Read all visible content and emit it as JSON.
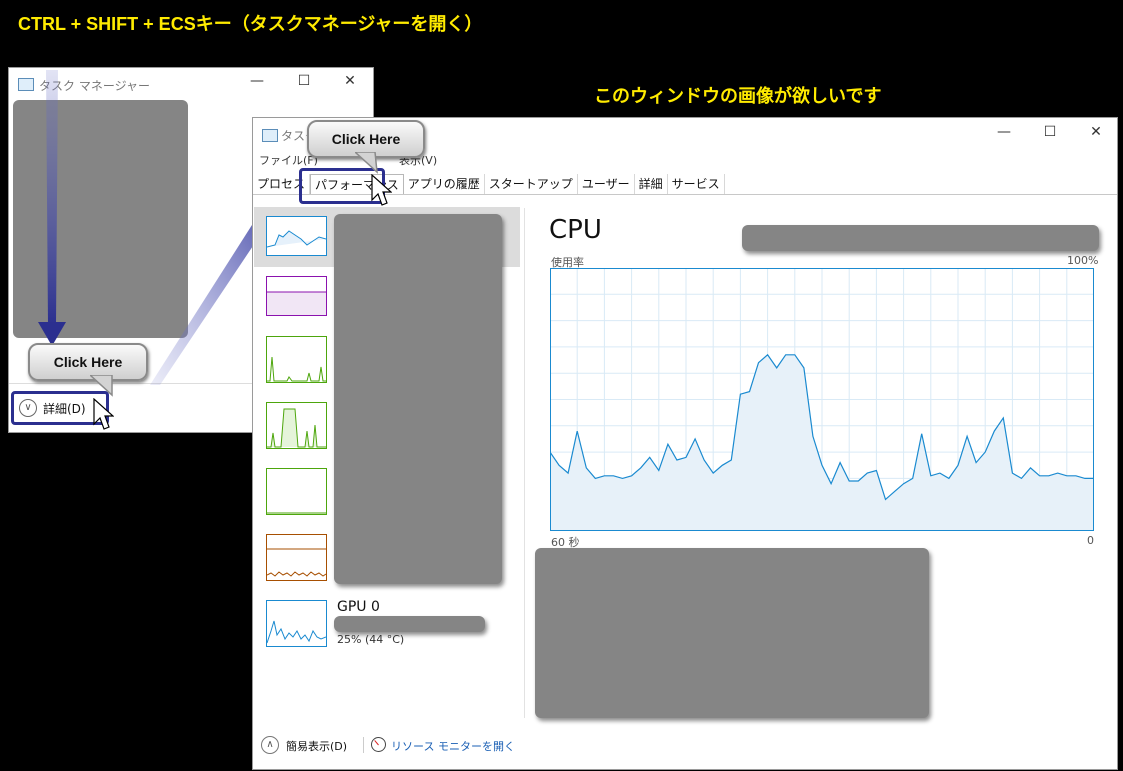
{
  "notes": {
    "top": "CTRL + SHIFT + ECSキー（タスクマネージャーを開く）",
    "window_note": "このウィンドウの画像が欲しいです"
  },
  "small_window": {
    "title": "タスク マネージャー",
    "details_label": "詳細(D)",
    "callout": "Click Here"
  },
  "main_window": {
    "title": "タスク",
    "menu": [
      "ファイル(F)",
      "表示(V)"
    ],
    "tabs": [
      "プロセス",
      "パフォーマンス",
      "アプリの履歴",
      "スタートアップ",
      "ユーザー",
      "詳細",
      "サービス"
    ],
    "active_tab_index": 1,
    "callout": "Click Here",
    "cpu": {
      "title": "CPU",
      "usage_label": "使用率",
      "max_label": "100%",
      "time_left": "60 秒",
      "time_right": "0"
    },
    "gpu": {
      "name": "GPU 0",
      "detail": "25%  (44 °C)"
    },
    "footer": {
      "fewer_details": "簡易表示(D)",
      "resource_monitor": "リソース モニターを開く"
    }
  },
  "colors": {
    "note_yellow": "#ffeb00",
    "highlight_blue": "#2b2f8f",
    "cpu_line": "#1a8ad0",
    "memory": "#8b12ae",
    "disk": "#4da60c",
    "ethernet": "#a74f01",
    "gpu": "#1a8ad0"
  },
  "icons": {
    "chevron_down": "chevron-down-icon",
    "chevron_up": "chevron-up-icon",
    "resource_monitor": "resource-monitor-icon",
    "task_manager": "task-manager-icon"
  },
  "chart_data": {
    "type": "area",
    "title": "CPU",
    "ylabel": "使用率",
    "ylim": [
      0,
      100
    ],
    "xlim": [
      60,
      0
    ],
    "x": [
      60,
      59,
      58,
      57,
      56,
      55,
      54,
      53,
      52,
      51,
      50,
      49,
      48,
      47,
      46,
      45,
      44,
      43,
      42,
      41,
      40,
      39,
      38,
      37,
      36,
      35,
      34,
      33,
      32,
      31,
      30,
      29,
      28,
      27,
      26,
      25,
      24,
      23,
      22,
      21,
      20,
      19,
      18,
      17,
      16,
      15,
      14,
      13,
      12,
      11,
      10,
      9,
      8,
      7,
      6,
      5,
      4,
      3,
      2,
      1,
      0
    ],
    "values": [
      30,
      25,
      22,
      38,
      24,
      20,
      21,
      21,
      20,
      21,
      24,
      28,
      23,
      33,
      27,
      28,
      35,
      27,
      22,
      25,
      27,
      52,
      53,
      64,
      67,
      62,
      67,
      67,
      62,
      36,
      25,
      18,
      26,
      19,
      19,
      22,
      23,
      12,
      15,
      18,
      20,
      37,
      21,
      22,
      20,
      25,
      36,
      26,
      30,
      38,
      43,
      22,
      20,
      24,
      21,
      21,
      22,
      21,
      21,
      20,
      20
    ],
    "grid": true
  }
}
